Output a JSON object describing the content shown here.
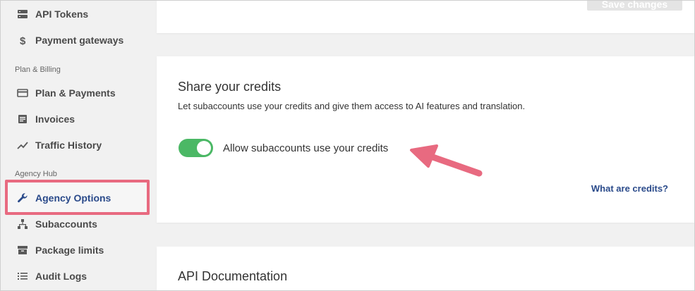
{
  "sidebar": {
    "items_top": [
      {
        "label": "API Tokens",
        "icon": "server-icon"
      },
      {
        "label": "Payment gateways",
        "icon": "dollar-icon"
      }
    ],
    "section_billing": "Plan & Billing",
    "items_billing": [
      {
        "label": "Plan & Payments",
        "icon": "credit-card-icon"
      },
      {
        "label": "Invoices",
        "icon": "document-icon"
      },
      {
        "label": "Traffic History",
        "icon": "trend-icon"
      }
    ],
    "section_agency": "Agency Hub",
    "items_agency": [
      {
        "label": "Agency Options",
        "icon": "wrench-icon",
        "active": true
      },
      {
        "label": "Subaccounts",
        "icon": "hierarchy-icon"
      },
      {
        "label": "Package limits",
        "icon": "archive-icon"
      },
      {
        "label": "Audit Logs",
        "icon": "list-icon"
      }
    ]
  },
  "top_card": {
    "save_label": "Save changes"
  },
  "credits_card": {
    "title": "Share your credits",
    "description": "Let subaccounts use your credits and give them access to AI features and translation.",
    "toggle_label": "Allow subaccounts use your credits",
    "toggle_on": true,
    "link": "What are credits?"
  },
  "api_card": {
    "title": "API Documentation"
  },
  "colors": {
    "accent": "#2a4a8a",
    "toggle_on": "#4bb865",
    "annotation": "#e86a80"
  }
}
